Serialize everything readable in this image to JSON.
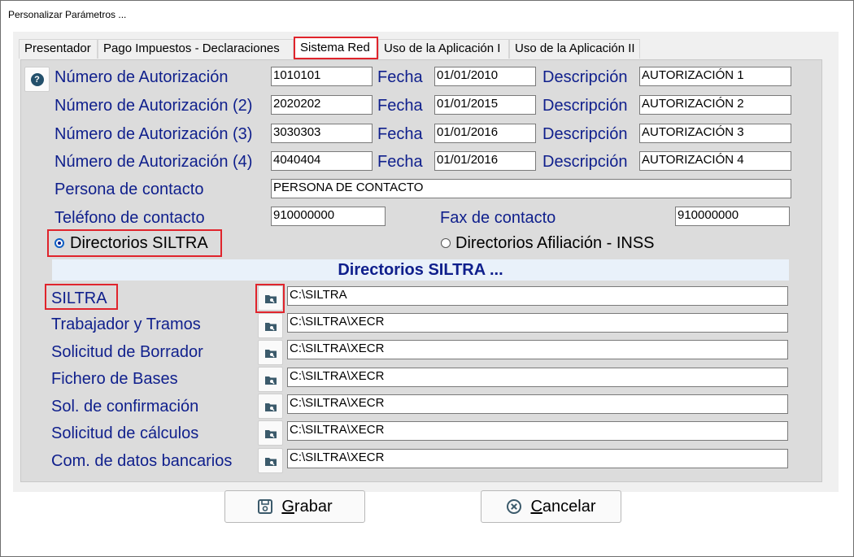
{
  "window": {
    "title": "Personalizar Parámetros ..."
  },
  "tabs": [
    {
      "label": "Presentador",
      "active": false
    },
    {
      "label": "Pago Impuestos - Declaraciones",
      "active": false
    },
    {
      "label": "Sistema Red",
      "active": true
    },
    {
      "label": "Uso de la Aplicación I",
      "active": false
    },
    {
      "label": "Uso de la Aplicación II",
      "active": false
    }
  ],
  "authorizations": [
    {
      "label": "Número de Autorización",
      "number": "1010101",
      "fecha_label": "Fecha",
      "fecha": "01/01/2010",
      "desc_label": "Descripción",
      "descripcion": "AUTORIZACIÓN 1"
    },
    {
      "label": "Número de Autorización (2)",
      "number": "2020202",
      "fecha_label": "Fecha",
      "fecha": "01/01/2015",
      "desc_label": "Descripción",
      "descripcion": "AUTORIZACIÓN 2"
    },
    {
      "label": "Número de Autorización (3)",
      "number": "3030303",
      "fecha_label": "Fecha",
      "fecha": "01/01/2016",
      "desc_label": "Descripción",
      "descripcion": "AUTORIZACIÓN 3"
    },
    {
      "label": "Número de Autorización (4)",
      "number": "4040404",
      "fecha_label": "Fecha",
      "fecha": "01/01/2016",
      "desc_label": "Descripción",
      "descripcion": "AUTORIZACIÓN 4"
    }
  ],
  "contact": {
    "persona_label": "Persona de contacto",
    "persona": "PERSONA DE CONTACTO",
    "telefono_label": "Teléfono de contacto",
    "telefono": "910000000",
    "fax_label": "Fax de contacto",
    "fax": "910000000"
  },
  "radios": {
    "siltra": {
      "label": "Directorios SILTRA",
      "selected": true
    },
    "afiliacion": {
      "label": "Directorios Afiliación - INSS",
      "selected": false
    }
  },
  "section_title": "Directorios SILTRA ...",
  "directories": [
    {
      "label": "SILTRA",
      "path": "C:\\SILTRA"
    },
    {
      "label": "Trabajador y Tramos",
      "path": "C:\\SILTRA\\XECR"
    },
    {
      "label": "Solicitud de Borrador",
      "path": "C:\\SILTRA\\XECR"
    },
    {
      "label": "Fichero de Bases",
      "path": "C:\\SILTRA\\XECR"
    },
    {
      "label": "Sol. de confirmación",
      "path": "C:\\SILTRA\\XECR"
    },
    {
      "label": "Solicitud de cálculos",
      "path": "C:\\SILTRA\\XECR"
    },
    {
      "label": "Com. de datos bancarios",
      "path": "C:\\SILTRA\\XECR"
    }
  ],
  "buttons": {
    "save": {
      "accel": "G",
      "rest": "rabar"
    },
    "cancel": {
      "accel": "C",
      "rest": "ancelar"
    }
  },
  "icons": {
    "help": "help-icon",
    "folder": "folder-search-icon",
    "save": "floppy-disk-icon",
    "cancel": "cancel-circle-icon"
  },
  "colors": {
    "label_blue": "#0f1f8c",
    "highlight_red": "#e0242c",
    "panel_gray": "#dcdcdc",
    "section_bg": "#e9f1fa"
  }
}
